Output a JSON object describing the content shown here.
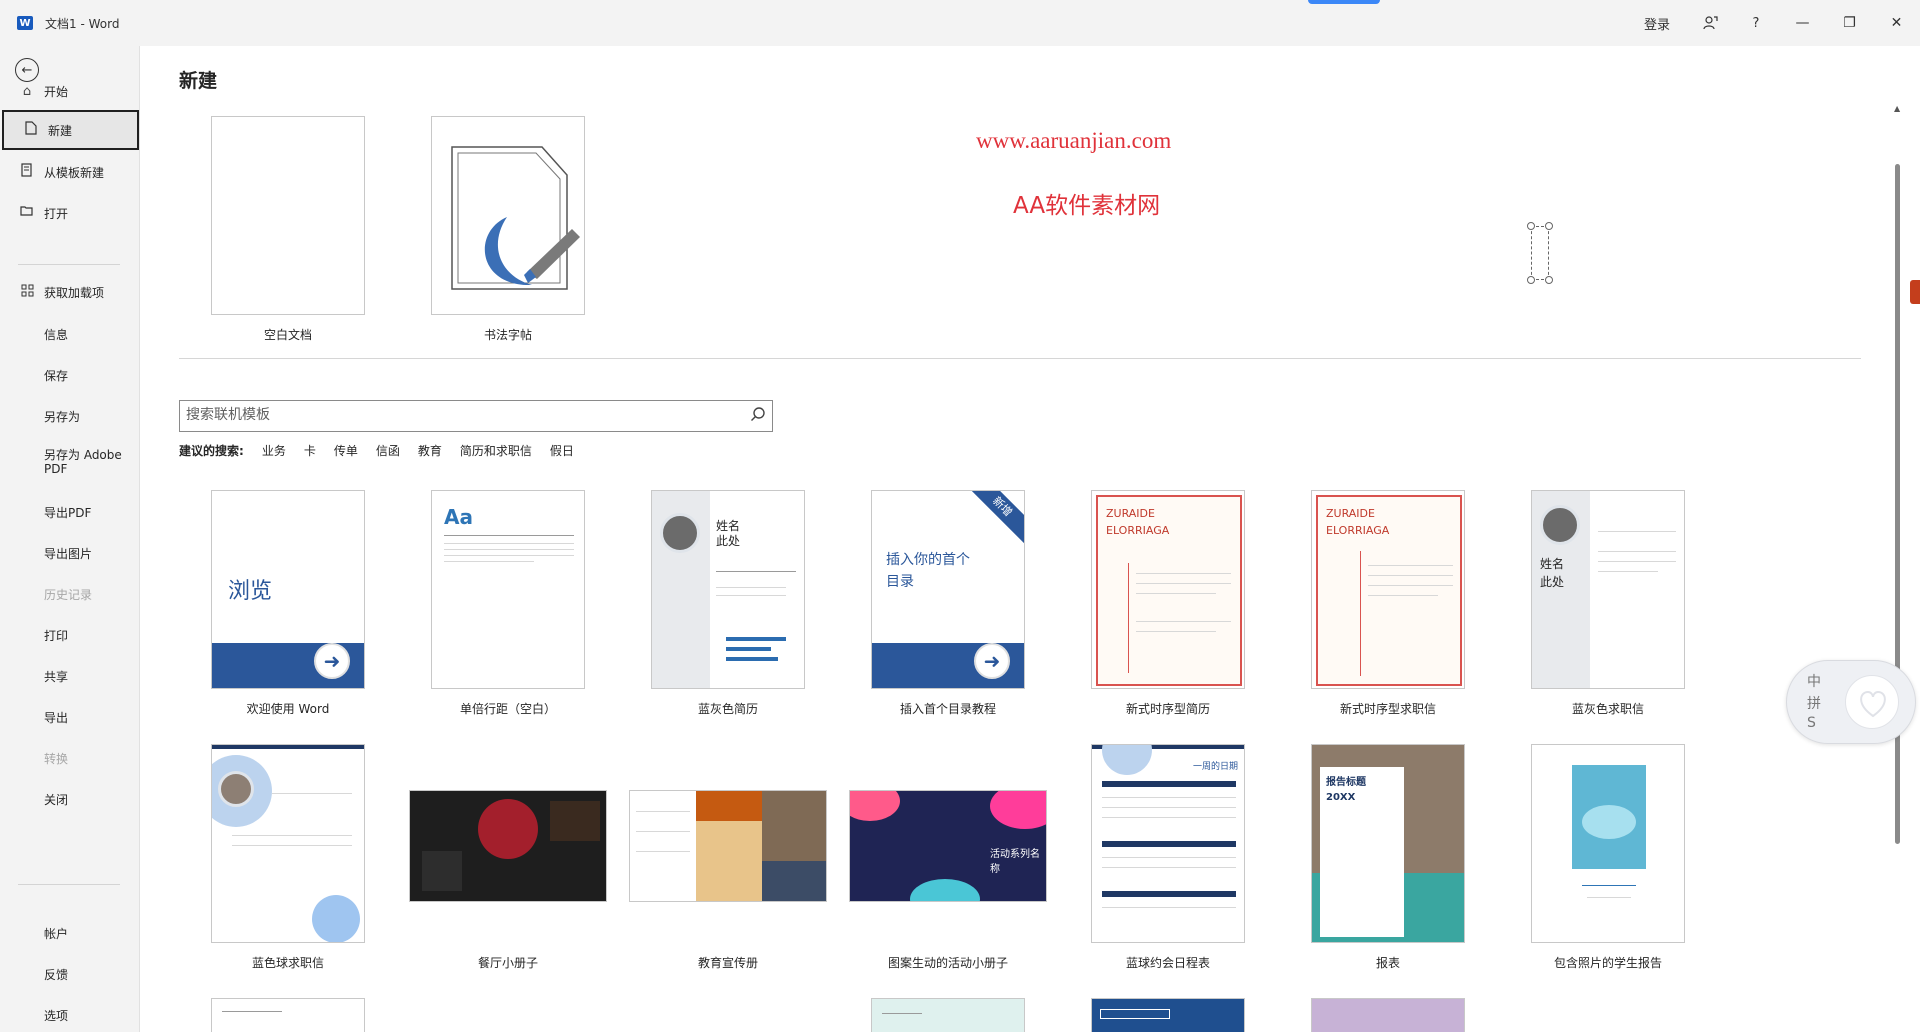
{
  "titlebar": {
    "app_icon": "word-logo",
    "title": "文档1  -  Word",
    "login": "登录",
    "feedback_icon": "person-feedback-icon",
    "help": "?",
    "minimize": "—",
    "restore": "❐",
    "close": "✕"
  },
  "sidebar": {
    "back_icon": "back-arrow-icon",
    "items": [
      {
        "label": "开始",
        "icon": "home-icon"
      },
      {
        "label": "新建",
        "icon": "new-document-icon",
        "active": true
      },
      {
        "label": "从模板新建",
        "icon": "template-icon"
      },
      {
        "label": "打开",
        "icon": "folder-open-icon"
      },
      {
        "label": "获取加载项",
        "icon": "addins-grid-icon"
      },
      {
        "label": "信息"
      },
      {
        "label": "保存"
      },
      {
        "label": "另存为"
      },
      {
        "label": "另存为 Adobe PDF"
      },
      {
        "label": "导出PDF"
      },
      {
        "label": "导出图片"
      },
      {
        "label": "历史记录",
        "disabled": true
      },
      {
        "label": "打印"
      },
      {
        "label": "共享"
      },
      {
        "label": "导出"
      },
      {
        "label": "转换",
        "disabled": true
      },
      {
        "label": "关闭"
      },
      {
        "label": "帐户"
      },
      {
        "label": "反馈"
      },
      {
        "label": "选项"
      }
    ]
  },
  "main": {
    "title": "新建",
    "top_templates": [
      {
        "caption": "空白文档"
      },
      {
        "caption": "书法字帖"
      }
    ],
    "watermark_url": "www.aaruanjian.com",
    "watermark_name": "AA软件素材网",
    "search": {
      "placeholder": "搜索联机模板",
      "icon": "search-icon"
    },
    "suggested": {
      "lead": "建议的搜索:",
      "tags": [
        "业务",
        "卡",
        "传单",
        "信函",
        "教育",
        "简历和求职信",
        "假日"
      ]
    },
    "row1": [
      {
        "caption": "欢迎使用 Word",
        "thumb_text": "浏览"
      },
      {
        "caption": "单倍行距（空白）",
        "thumb_text": "Aa"
      },
      {
        "caption": "蓝灰色简历",
        "thumb_text": "姓名\n此处"
      },
      {
        "caption": "插入首个目录教程",
        "thumb_text": "插入你的首个\n目录",
        "badge": "新增"
      },
      {
        "caption": "新式时序型简历",
        "thumb_text": "ZURAIDE\nELORRIAGA"
      },
      {
        "caption": "新式时序型求职信",
        "thumb_text": "ZURAIDE\nELORRIAGA"
      },
      {
        "caption": "蓝灰色求职信",
        "thumb_text": "姓名\n此处"
      }
    ],
    "row2": [
      {
        "caption": "蓝色球求职信"
      },
      {
        "caption": "餐厅小册子"
      },
      {
        "caption": "教育宣传册"
      },
      {
        "caption": "图案生动的活动小册子",
        "thumb_text": "活动系列名称"
      },
      {
        "caption": "蓝球约会日程表",
        "thumb_text": "一周的日期"
      },
      {
        "caption": "报表",
        "thumb_text": "报告标题\n20XX"
      },
      {
        "caption": "包含照片的学生报告"
      }
    ]
  },
  "ime": {
    "chars": [
      "中",
      "拼",
      "S"
    ]
  },
  "colors": {
    "accent": "#2b579a",
    "watermark": "#e0323a",
    "sidebar_bg": "#f3f3f3"
  }
}
